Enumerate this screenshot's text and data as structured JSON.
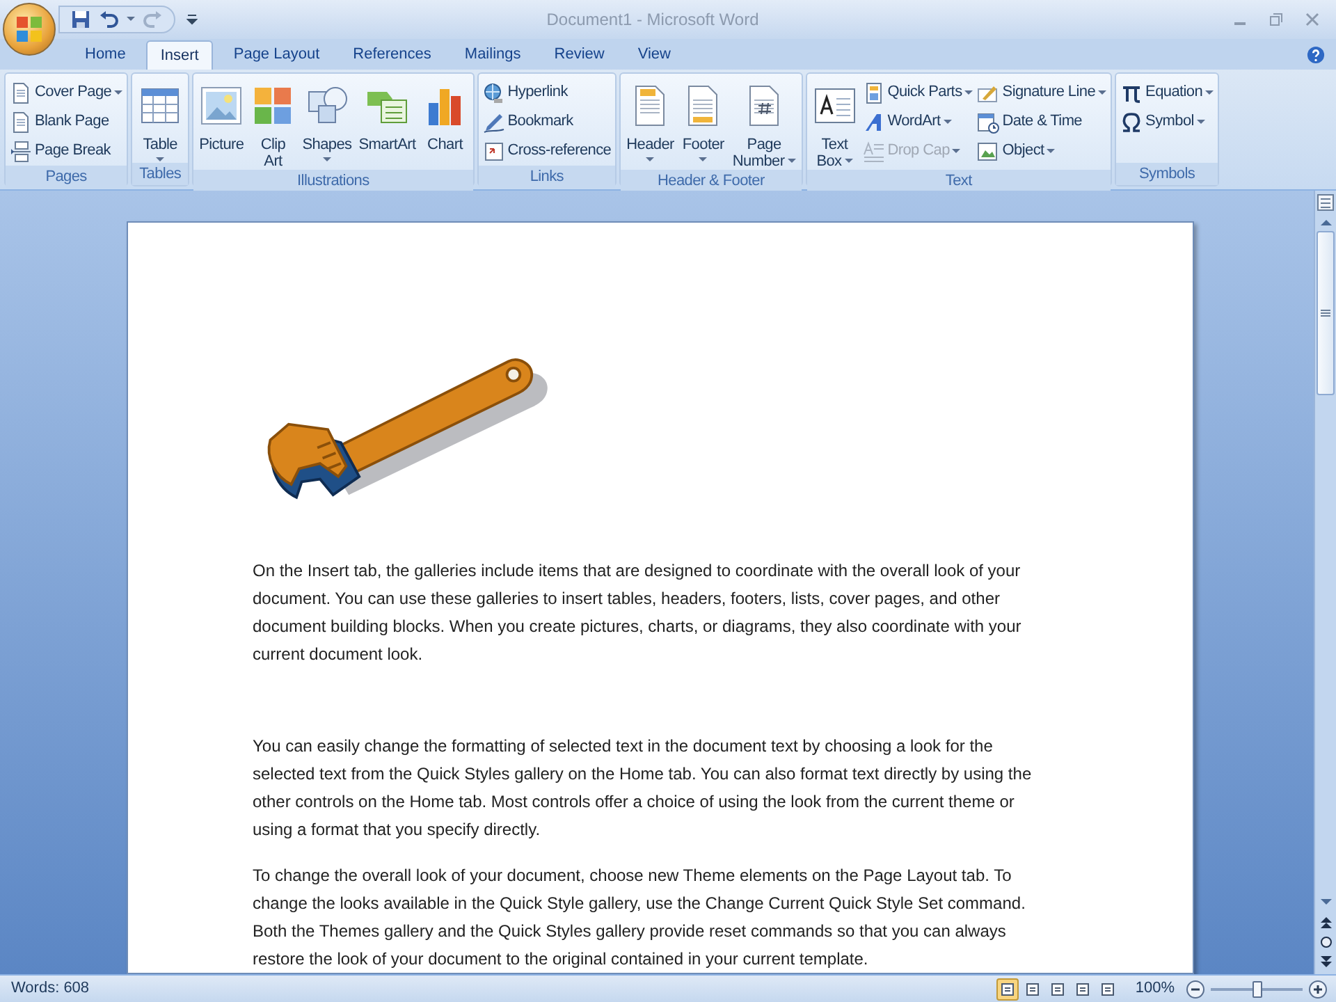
{
  "window": {
    "title": "Document1 - Microsoft Word"
  },
  "tabs": [
    {
      "label": "Home",
      "selected": false
    },
    {
      "label": "Insert",
      "selected": true
    },
    {
      "label": "Page Layout",
      "selected": false
    },
    {
      "label": "References",
      "selected": false
    },
    {
      "label": "Mailings",
      "selected": false
    },
    {
      "label": "Review",
      "selected": false
    },
    {
      "label": "View",
      "selected": false
    }
  ],
  "ribbon": {
    "groups": [
      {
        "label": "Pages",
        "items": [
          {
            "kind": "small",
            "label": "Cover Page",
            "dropdown": true,
            "disabled": false
          },
          {
            "kind": "small",
            "label": "Blank Page",
            "dropdown": false,
            "disabled": false
          },
          {
            "kind": "small",
            "label": "Page Break",
            "dropdown": false,
            "disabled": false
          }
        ]
      },
      {
        "label": "Tables",
        "items": [
          {
            "kind": "large",
            "lines": [
              "Table"
            ],
            "dropdown": true,
            "disabled": false
          }
        ]
      },
      {
        "label": "Illustrations",
        "items": [
          {
            "kind": "large",
            "lines": [
              "Picture"
            ],
            "dropdown": false,
            "disabled": false
          },
          {
            "kind": "large",
            "lines": [
              "Clip",
              "Art"
            ],
            "dropdown": false,
            "disabled": false
          },
          {
            "kind": "large",
            "lines": [
              "Shapes"
            ],
            "dropdown": true,
            "disabled": false
          },
          {
            "kind": "large",
            "lines": [
              "SmartArt"
            ],
            "dropdown": false,
            "disabled": false
          },
          {
            "kind": "large",
            "lines": [
              "Chart"
            ],
            "dropdown": false,
            "disabled": false
          }
        ]
      },
      {
        "label": "Links",
        "items": [
          {
            "kind": "small",
            "label": "Hyperlink",
            "dropdown": false,
            "disabled": false
          },
          {
            "kind": "small",
            "label": "Bookmark",
            "dropdown": false,
            "disabled": false
          },
          {
            "kind": "small",
            "label": "Cross-reference",
            "dropdown": false,
            "disabled": false
          }
        ]
      },
      {
        "label": "Header & Footer",
        "items": [
          {
            "kind": "large",
            "lines": [
              "Header"
            ],
            "dropdown": true,
            "disabled": false
          },
          {
            "kind": "large",
            "lines": [
              "Footer"
            ],
            "dropdown": true,
            "disabled": false
          },
          {
            "kind": "large",
            "lines": [
              "Page",
              "Number"
            ],
            "dropdown": true,
            "disabled": false
          }
        ]
      },
      {
        "label": "Text",
        "items": [
          {
            "kind": "large",
            "lines": [
              "Text",
              "Box"
            ],
            "dropdown": true,
            "disabled": false
          },
          {
            "kind": "small",
            "label": "Quick Parts",
            "dropdown": true,
            "disabled": false
          },
          {
            "kind": "small",
            "label": "WordArt",
            "dropdown": true,
            "disabled": false
          },
          {
            "kind": "small",
            "label": "Drop Cap",
            "dropdown": true,
            "disabled": true
          },
          {
            "kind": "small",
            "label": "Signature Line",
            "dropdown": true,
            "disabled": false
          },
          {
            "kind": "small",
            "label": "Date & Time",
            "dropdown": false,
            "disabled": false
          },
          {
            "kind": "small",
            "label": "Object",
            "dropdown": true,
            "disabled": false
          }
        ]
      },
      {
        "label": "Symbols",
        "items": [
          {
            "kind": "small",
            "label": "Equation",
            "dropdown": true,
            "disabled": false
          },
          {
            "kind": "small",
            "label": "Symbol",
            "dropdown": true,
            "disabled": false
          }
        ]
      }
    ]
  },
  "document": {
    "paragraphs": [
      "On the Insert tab, the galleries include items that are designed to coordinate with the overall look of your document. You can use these galleries to insert tables, headers, footers, lists, cover pages, and other document building blocks. When you create pictures, charts, or diagrams, they also coordinate with your current document look.",
      "You can easily change the formatting of selected text in the document text by choosing a look for the selected text from the Quick Styles gallery on the Home tab. You can also format text directly by using the other controls on the Home tab. Most controls offer a choice of using the look from the current theme or using a format that you specify directly.",
      "To change the overall look of your document, choose new Theme elements on the Page Layout tab. To change the looks available in the Quick Style gallery, use the Change Current Quick Style Set command. Both the Themes gallery and the Quick Styles gallery provide reset commands so that you can always restore the look of your document to the original contained in your current template."
    ]
  },
  "status_bar": {
    "words": "Words: 608",
    "views": [
      {
        "selected": true
      },
      {
        "selected": false
      },
      {
        "selected": false
      },
      {
        "selected": false
      },
      {
        "selected": false
      }
    ],
    "zoom": {
      "label": "100%",
      "level": 0.5
    }
  }
}
